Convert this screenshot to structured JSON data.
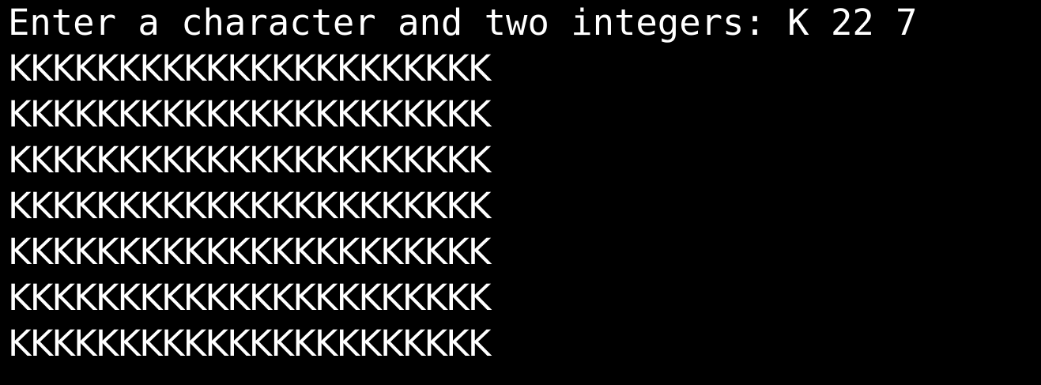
{
  "terminal": {
    "background": "#000000",
    "foreground": "#ffffff",
    "prompt": "Enter a character and two integers: K 22 7",
    "output_lines": [
      "KKKKKKKKKKKKKKKKKKKKKK",
      "KKKKKKKKKKKKKKKKKKKKKK",
      "KKKKKKKKKKKKKKKKKKKKKK",
      "KKKKKKKKKKKKKKKKKKKKKK",
      "KKKKKKKKKKKKKKKKKKKKKK",
      "KKKKKKKKKKKKKKKKKKKKKK",
      "KKKKKKKKKKKKKKKKKKKKKK"
    ]
  }
}
